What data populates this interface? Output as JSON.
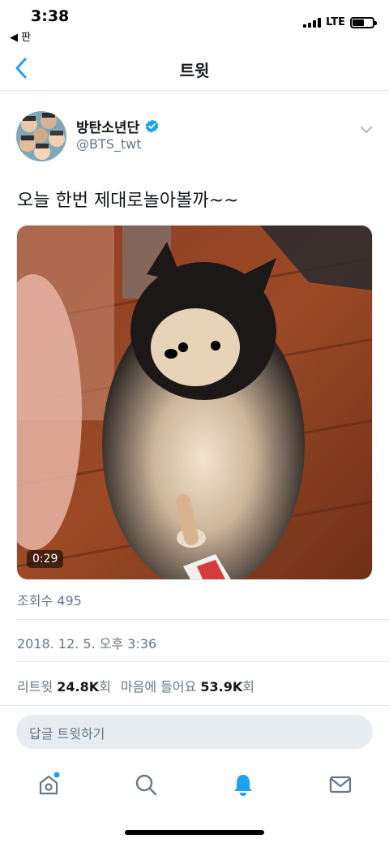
{
  "status_bar": {
    "time": "3:38",
    "back_app": "◀ 판",
    "network": "LTE",
    "battery_level": 0.6
  },
  "nav": {
    "title": "트윗",
    "back_icon": "chevron-left-icon"
  },
  "tweet": {
    "author_name": "방탄소년단",
    "author_handle": "@BTS_twt",
    "verified": true,
    "text": "오늘 한번 제대로놀아볼까~~",
    "media": {
      "type": "video",
      "duration": "0:29"
    },
    "views_label": "조회수",
    "views_count": "495",
    "timestamp": "2018. 12. 5. 오후 3:36",
    "retweets_label": "리트윗",
    "retweets_count": "24.8K",
    "retweets_suffix": "회",
    "likes_label": "마음에 들어요",
    "likes_count": "53.9K",
    "likes_suffix": "회"
  },
  "reply": {
    "placeholder": "답글 트윗하기"
  },
  "tab_bar": {
    "tabs": [
      "home-icon",
      "search-icon",
      "notifications-icon",
      "messages-icon"
    ],
    "active": "notifications-icon"
  },
  "colors": {
    "accent": "#1da1f2",
    "secondary_text": "#657786",
    "divider": "#e1e8ed",
    "reply_bg": "#e6ecf0"
  }
}
